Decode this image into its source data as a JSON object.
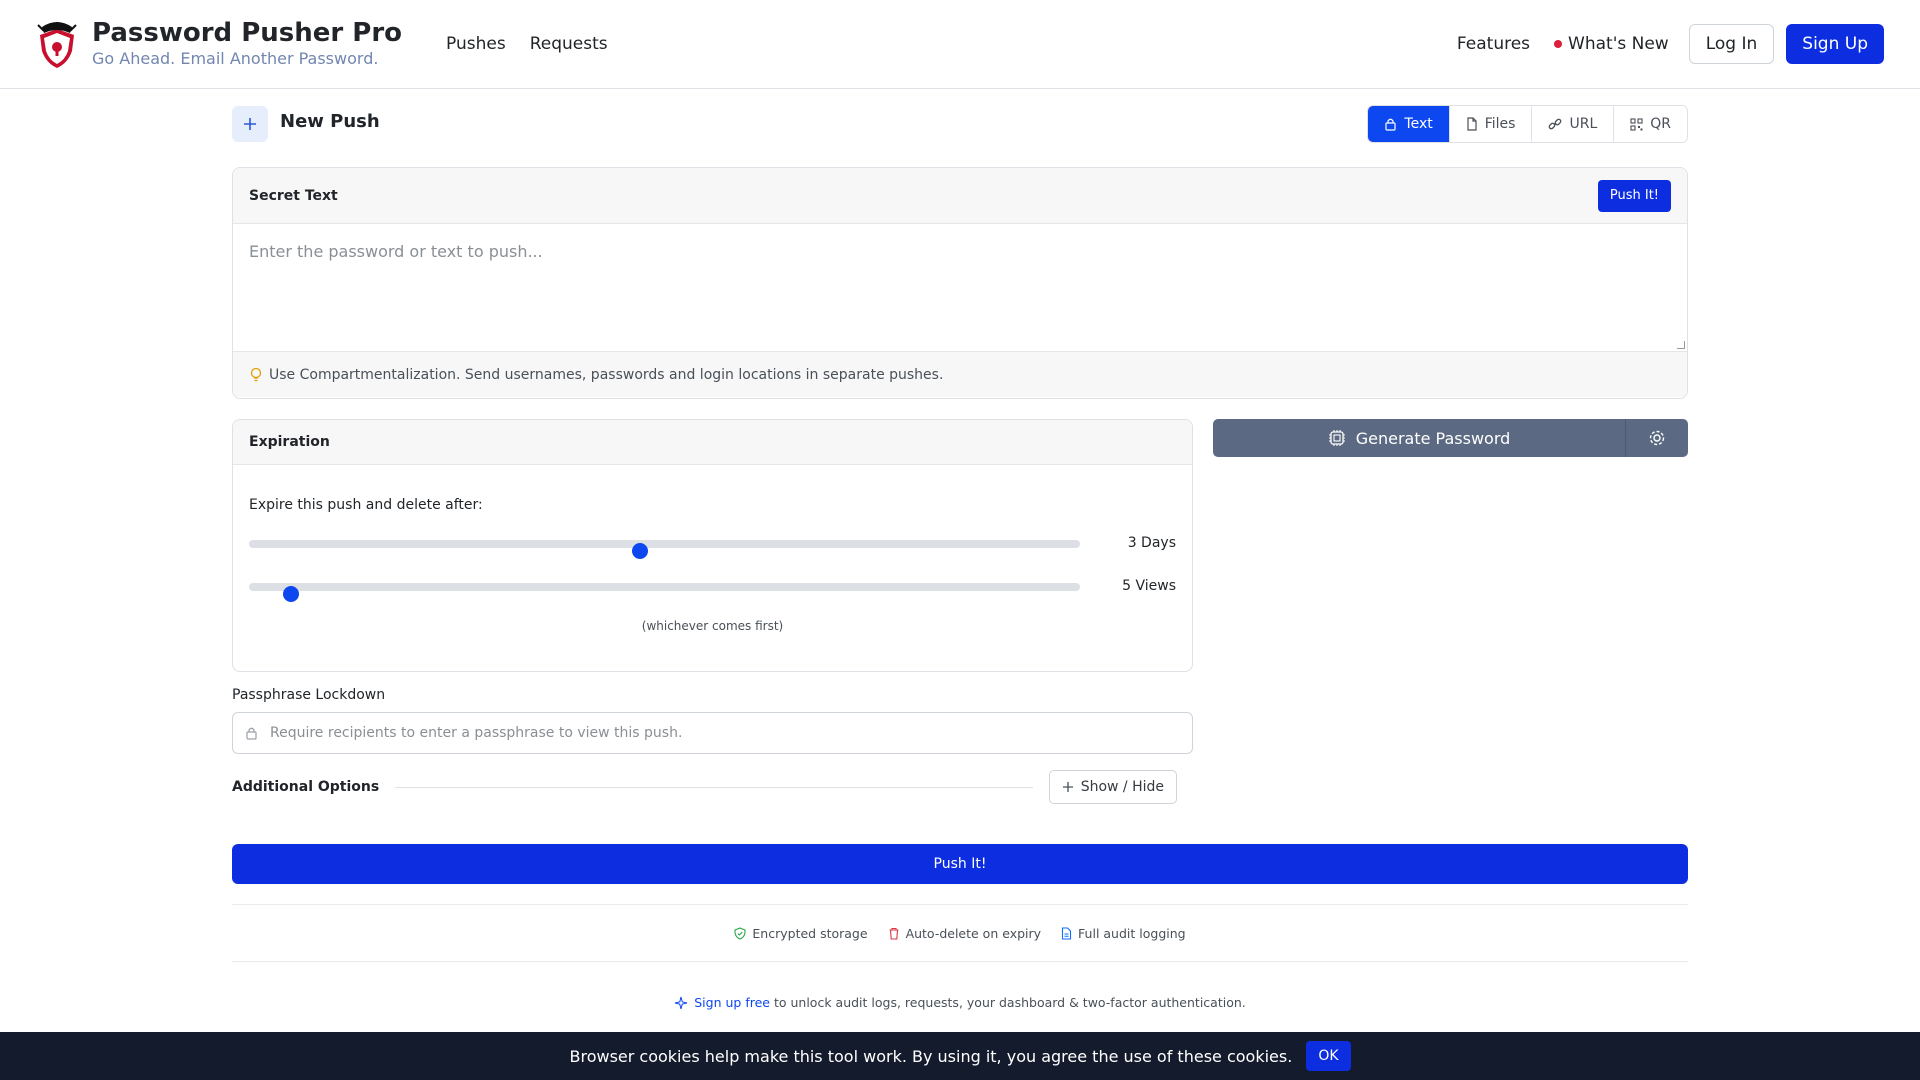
{
  "brand": {
    "title": "Password Pusher Pro",
    "tagline": "Go Ahead. Email Another Password."
  },
  "nav": {
    "pushes": "Pushes",
    "requests": "Requests",
    "features": "Features",
    "whats_new": "What's New",
    "login": "Log In",
    "signup": "Sign Up"
  },
  "page": {
    "title": "New Push",
    "tabs": [
      {
        "label": "Text",
        "icon": "lock-icon",
        "active": true
      },
      {
        "label": "Files",
        "icon": "file-icon",
        "active": false
      },
      {
        "label": "URL",
        "icon": "link-icon",
        "active": false
      },
      {
        "label": "QR",
        "icon": "qr-icon",
        "active": false
      }
    ]
  },
  "secret": {
    "header": "Secret Text",
    "push_button": "Push It!",
    "placeholder": "Enter the password or text to push...",
    "tip": "Use Compartmentalization. Send usernames, passwords and login locations in separate pushes."
  },
  "expiration": {
    "header": "Expiration",
    "label": "Expire this push and delete after:",
    "days_value": "3 Days",
    "days_level": 0.47,
    "views_value": "5 Views",
    "views_level": 0.05,
    "note": "(whichever comes first)"
  },
  "generate": {
    "label": "Generate Password"
  },
  "passphrase": {
    "label": "Passphrase Lockdown",
    "placeholder": "Require recipients to enter a passphrase to view this push."
  },
  "additional": {
    "label": "Additional Options",
    "toggle": "Show / Hide"
  },
  "submit": "Push It!",
  "features": [
    {
      "label": "Encrypted storage",
      "icon": "shield-check-icon",
      "color": "#28a745"
    },
    {
      "label": "Auto-delete on expiry",
      "icon": "trash-icon",
      "color": "#dc3545"
    },
    {
      "label": "Full audit logging",
      "icon": "document-icon",
      "color": "#0d6efd"
    }
  ],
  "signup_note": {
    "link": "Sign up free",
    "text": "to unlock audit logs, requests, your dashboard & two-factor authentication."
  },
  "cookie": {
    "text": "Browser cookies help make this tool work. By using it, you agree the use of these cookies.",
    "ok": "OK"
  },
  "colors": {
    "primary": "#0d2ee0",
    "accent": "#0d47f0",
    "generate_bg": "#5b6a82",
    "cookie_bg": "#141b2d"
  }
}
